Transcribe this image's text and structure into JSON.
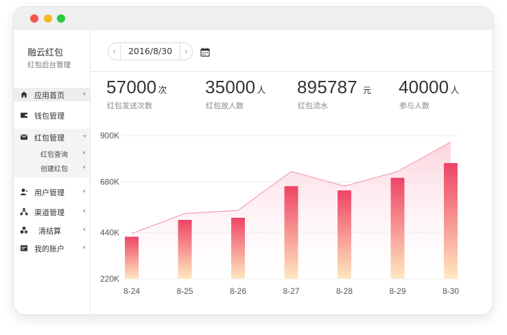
{
  "sidebar": {
    "brand_title": "融云红包",
    "brand_subtitle": "红包后台管理",
    "items": [
      {
        "label": "应用首页",
        "icon": "home-icon"
      },
      {
        "label": "钱包管理",
        "icon": "wallet-icon"
      },
      {
        "label": "红包管理",
        "icon": "envelope-icon"
      },
      {
        "label": "用户管理",
        "icon": "user-icon"
      },
      {
        "label": "渠道管理",
        "icon": "channel-icon"
      },
      {
        "label": "清结算",
        "icon": "settlement-icon"
      },
      {
        "label": "我的账户",
        "icon": "account-icon"
      }
    ],
    "subitems": [
      {
        "label": "红包查询"
      },
      {
        "label": "创建红包"
      }
    ]
  },
  "toolbar": {
    "date": "2016/8/30",
    "prev_label": "‹",
    "next_label": "›"
  },
  "stats": [
    {
      "value": "57000",
      "unit": "次",
      "label": "红包发送次数"
    },
    {
      "value": "35000",
      "unit": "人",
      "label": "红包放人数"
    },
    {
      "value": "895787",
      "unit": "元",
      "label": "红包流水"
    },
    {
      "value": "40000",
      "unit": "人",
      "label": "参与人数"
    }
  ],
  "colors": {
    "bar_top": "#ee4466",
    "bar_bottom": "#ffe8bf",
    "area_line": "#f4a0b0",
    "area_fill": "#fbd0da"
  },
  "chart_data": {
    "type": "bar",
    "categories": [
      "8-24",
      "8-25",
      "8-26",
      "8-27",
      "8-28",
      "8-29",
      "8-30"
    ],
    "series": [
      {
        "type": "bar",
        "values": [
          420000,
          500000,
          510000,
          660000,
          640000,
          700000,
          770000
        ]
      },
      {
        "type": "area",
        "values": [
          435000,
          530000,
          545000,
          730000,
          660000,
          730000,
          870000
        ]
      }
    ],
    "yticks": [
      "220K",
      "440K",
      "680K",
      "900K"
    ],
    "ylim": [
      220000,
      900000
    ],
    "grid": true
  }
}
